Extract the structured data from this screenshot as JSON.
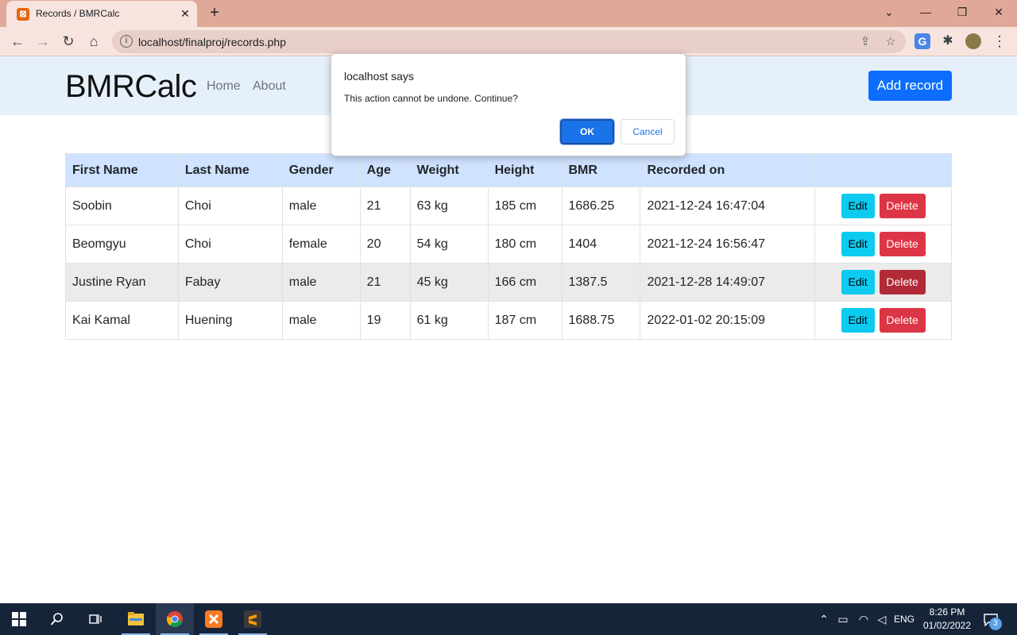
{
  "browser": {
    "tab_title": "Records / BMRCalc",
    "tab_close": "✕",
    "new_tab": "+",
    "url": "localhost/finalproj/records.php",
    "window_controls": {
      "dropdown": "⌄",
      "minimize": "—",
      "restore": "❐",
      "close": "✕"
    },
    "nav": {
      "back": "←",
      "forward": "→",
      "reload": "↻",
      "home": "⌂"
    },
    "omnibox_actions": {
      "share": "⇪",
      "bookmark": "☆"
    },
    "menu": "⋮"
  },
  "site": {
    "brand": "BMRCalc",
    "nav_links": [
      "Home",
      "About"
    ],
    "add_button": "Add record"
  },
  "table": {
    "headers": [
      "First Name",
      "Last Name",
      "Gender",
      "Age",
      "Weight",
      "Height",
      "BMR",
      "Recorded on",
      ""
    ],
    "rows": [
      {
        "first": "Soobin",
        "last": "Choi",
        "gender": "male",
        "age": "21",
        "weight": "63 kg",
        "height": "185 cm",
        "bmr": "1686.25",
        "recorded": "2021-12-24 16:47:04"
      },
      {
        "first": "Beomgyu",
        "last": "Choi",
        "gender": "female",
        "age": "20",
        "weight": "54 kg",
        "height": "180 cm",
        "bmr": "1404",
        "recorded": "2021-12-24 16:56:47"
      },
      {
        "first": "Justine Ryan",
        "last": "Fabay",
        "gender": "male",
        "age": "21",
        "weight": "45 kg",
        "height": "166 cm",
        "bmr": "1387.5",
        "recorded": "2021-12-28 14:49:07"
      },
      {
        "first": "Kai Kamal",
        "last": "Huening",
        "gender": "male",
        "age": "19",
        "weight": "61 kg",
        "height": "187 cm",
        "bmr": "1688.75",
        "recorded": "2022-01-02 20:15:09"
      }
    ],
    "edit_label": "Edit",
    "delete_label": "Delete"
  },
  "dialog": {
    "title": "localhost says",
    "message": "This action cannot be undone. Continue?",
    "ok": "OK",
    "cancel": "Cancel"
  },
  "taskbar": {
    "language": "ENG",
    "time": "8:26 PM",
    "date": "01/02/2022",
    "notification_count": "3"
  },
  "colors": {
    "tabbar": "#e0a898",
    "navbar_bg": "#e6f0fb",
    "primary": "#0d6efd",
    "table_header": "#cfe2ff",
    "edit_button": "#0dcaf0",
    "delete_button": "#dc3545",
    "taskbar": "#16243a"
  }
}
